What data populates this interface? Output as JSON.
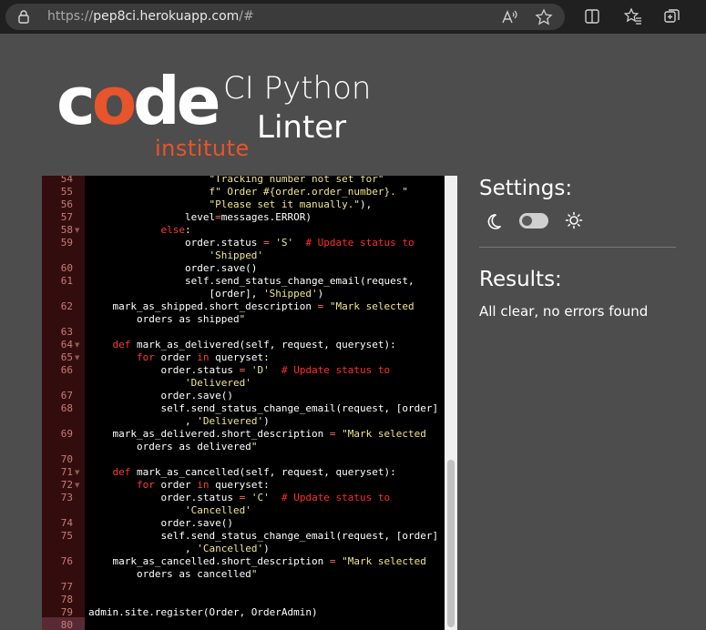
{
  "browser": {
    "url_scheme": "https://",
    "url_host": "pep8ci.herokuapp.com",
    "url_path": "/#"
  },
  "logo": {
    "code_c": "c",
    "code_o": "o",
    "code_de": "de",
    "institute": "institute",
    "title_line1": "CI Python",
    "title_line2": "Linter"
  },
  "editor": {
    "lines": [
      {
        "n": "54",
        "code": "                    \"Tracking number not set for\""
      },
      {
        "n": "55",
        "code": "                    f\" Order #{order.order_number}. \""
      },
      {
        "n": "56",
        "code": "                    \"Please set it manually.\"),"
      },
      {
        "n": "57",
        "code": "                level=messages.ERROR)"
      },
      {
        "n": "58",
        "code": "            else:"
      },
      {
        "n": "59",
        "code": "                order.status = 'S'  # Update status to"
      },
      {
        "n": "",
        "code": "                    'Shipped'"
      },
      {
        "n": "60",
        "code": "                order.save()"
      },
      {
        "n": "61",
        "code": "                self.send_status_change_email(request,"
      },
      {
        "n": "",
        "code": "                    [order], 'Shipped')"
      },
      {
        "n": "62",
        "code": "    mark_as_shipped.short_description = \"Mark selected"
      },
      {
        "n": "",
        "code": "        orders as shipped\""
      },
      {
        "n": "63",
        "code": ""
      },
      {
        "n": "64",
        "code": "    def mark_as_delivered(self, request, queryset):"
      },
      {
        "n": "65",
        "code": "        for order in queryset:"
      },
      {
        "n": "66",
        "code": "            order.status = 'D'  # Update status to"
      },
      {
        "n": "",
        "code": "                'Delivered'"
      },
      {
        "n": "67",
        "code": "            order.save()"
      },
      {
        "n": "68",
        "code": "            self.send_status_change_email(request, [order]"
      },
      {
        "n": "",
        "code": "                , 'Delivered')"
      },
      {
        "n": "69",
        "code": "    mark_as_delivered.short_description = \"Mark selected"
      },
      {
        "n": "",
        "code": "        orders as delivered\""
      },
      {
        "n": "70",
        "code": ""
      },
      {
        "n": "71",
        "code": "    def mark_as_cancelled(self, request, queryset):"
      },
      {
        "n": "72",
        "code": "        for order in queryset:"
      },
      {
        "n": "73",
        "code": "            order.status = 'C'  # Update status to"
      },
      {
        "n": "",
        "code": "                'Cancelled'"
      },
      {
        "n": "74",
        "code": "            order.save()"
      },
      {
        "n": "75",
        "code": "            self.send_status_change_email(request, [order]"
      },
      {
        "n": "",
        "code": "                , 'Cancelled')"
      },
      {
        "n": "76",
        "code": "    mark_as_cancelled.short_description = \"Mark selected"
      },
      {
        "n": "",
        "code": "        orders as cancelled\""
      },
      {
        "n": "77",
        "code": ""
      },
      {
        "n": "78",
        "code": ""
      },
      {
        "n": "79",
        "code": "admin.site.register(Order, OrderAdmin)"
      },
      {
        "n": "80",
        "code": ""
      }
    ],
    "fold_lines": [
      "58",
      "64",
      "65",
      "71",
      "72"
    ]
  },
  "settings": {
    "heading": "Settings:"
  },
  "results": {
    "heading": "Results:",
    "text": "All clear, no errors found"
  },
  "colors": {
    "accent": "#e8542b",
    "page_bg": "#4d4d4d",
    "editor_bg": "#000000",
    "gutter_bg": "#330d0d"
  }
}
